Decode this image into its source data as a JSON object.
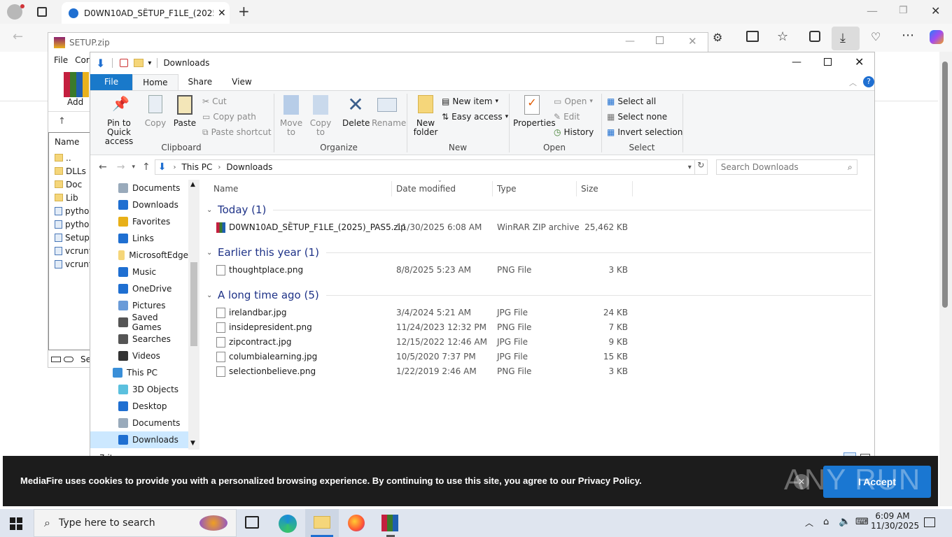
{
  "edge": {
    "tab_title": "D0WN10AD_SȄTUP_F1LE_(2025)_PAS5.zip",
    "tab_title_display": "D0WN10AD_SȄTUP_F1LE_(2025)_I"
  },
  "rar": {
    "title": "SETUP.zip",
    "menu": [
      "File",
      "Cor"
    ],
    "add_label": "Add",
    "col_name": "Name",
    "files": [
      "..",
      "DLLs",
      "Doc",
      "Lib",
      "python",
      "python",
      "Setup.",
      "vcrunt",
      "vcrunt"
    ],
    "status": "Se"
  },
  "explorer": {
    "title": "Downloads",
    "tabs": {
      "file": "File",
      "home": "Home",
      "share": "Share",
      "view": "View"
    },
    "clipboard": {
      "pin": "Pin to Quick access",
      "copy": "Copy",
      "paste": "Paste",
      "cut": "Cut",
      "copy_path": "Copy path",
      "paste_shortcut": "Paste shortcut",
      "label": "Clipboard"
    },
    "organize": {
      "move": "Move to",
      "copy": "Copy to",
      "delete": "Delete",
      "rename": "Rename",
      "label": "Organize"
    },
    "new": {
      "folder": "New folder",
      "item": "New item",
      "easy": "Easy access",
      "label": "New"
    },
    "open": {
      "properties": "Properties",
      "open": "Open",
      "edit": "Edit",
      "history": "History",
      "label": "Open"
    },
    "select": {
      "all": "Select all",
      "none": "Select none",
      "invert": "Invert selection",
      "label": "Select"
    },
    "address": {
      "root": "This PC",
      "current": "Downloads"
    },
    "search_placeholder": "Search Downloads",
    "nav": [
      {
        "label": "Documents",
        "icon": "documents-icon"
      },
      {
        "label": "Downloads",
        "icon": "downloads-icon"
      },
      {
        "label": "Favorites",
        "icon": "favorites-icon"
      },
      {
        "label": "Links",
        "icon": "links-icon"
      },
      {
        "label": "MicrosoftEdge",
        "icon": "folder-icon"
      },
      {
        "label": "Music",
        "icon": "music-icon"
      },
      {
        "label": "OneDrive",
        "icon": "onedrive-icon"
      },
      {
        "label": "Pictures",
        "icon": "pictures-icon"
      },
      {
        "label": "Saved Games",
        "icon": "saved-games-icon"
      },
      {
        "label": "Searches",
        "icon": "searches-icon"
      },
      {
        "label": "Videos",
        "icon": "videos-icon"
      },
      {
        "label": "This PC",
        "icon": "this-pc-icon"
      },
      {
        "label": "3D Objects",
        "icon": "3d-objects-icon"
      },
      {
        "label": "Desktop",
        "icon": "desktop-icon"
      },
      {
        "label": "Documents",
        "icon": "documents-icon"
      },
      {
        "label": "Downloads",
        "icon": "downloads-icon"
      }
    ],
    "columns": {
      "name": "Name",
      "date": "Date modified",
      "type": "Type",
      "size": "Size"
    },
    "groups": [
      {
        "header": "Today (1)",
        "files": [
          {
            "name": "D0WN10AD_SȄTUP_F1LE_(2025)_PAS5.zip",
            "date": "11/30/2025 6:08 AM",
            "type": "WinRAR ZIP archive",
            "size": "25,462 KB",
            "icon": "winrar-zip-icon"
          }
        ]
      },
      {
        "header": "Earlier this year (1)",
        "files": [
          {
            "name": "thoughtplace.png",
            "date": "8/8/2025 5:23 AM",
            "type": "PNG File",
            "size": "3 KB",
            "icon": "image-file-icon"
          }
        ]
      },
      {
        "header": "A long time ago (5)",
        "files": [
          {
            "name": "irelandbar.jpg",
            "date": "3/4/2024 5:21 AM",
            "type": "JPG File",
            "size": "24 KB",
            "icon": "image-file-icon"
          },
          {
            "name": "insidepresident.png",
            "date": "11/24/2023 12:32 PM",
            "type": "PNG File",
            "size": "7 KB",
            "icon": "image-file-icon"
          },
          {
            "name": "zipcontract.jpg",
            "date": "12/15/2022 12:46 AM",
            "type": "JPG File",
            "size": "9 KB",
            "icon": "image-file-icon"
          },
          {
            "name": "columbialearning.jpg",
            "date": "10/5/2020 7:37 PM",
            "type": "JPG File",
            "size": "15 KB",
            "icon": "image-file-icon"
          },
          {
            "name": "selectionbelieve.png",
            "date": "1/22/2019 2:46 AM",
            "type": "PNG File",
            "size": "3 KB",
            "icon": "image-file-icon"
          }
        ]
      }
    ],
    "status": "7 items"
  },
  "cookie": {
    "text": "MediaFire uses cookies to provide you with a personalized browsing experience. By continuing to use this site, you agree to our Privacy Policy.",
    "accept": "I Accept",
    "watermark": "ANY RUN"
  },
  "taskbar": {
    "search_placeholder": "Type here to search",
    "time": "6:09 AM",
    "date": "11/30/2025"
  },
  "colors": {
    "accent": "#1979ca",
    "ribbon_bg": "#f5f6f7",
    "cookie_bg": "#1c1c1c",
    "accept_btn": "#1a77d2"
  }
}
